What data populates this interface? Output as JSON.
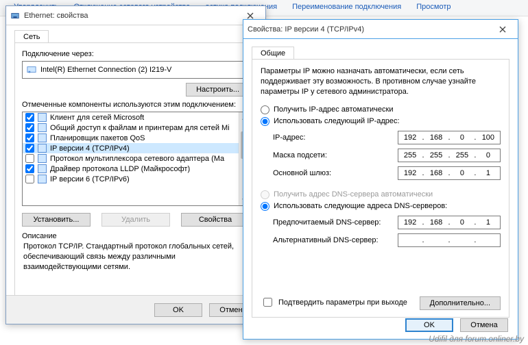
{
  "bgmenu": [
    "Упорядочить",
    "Отключение сетевого устройства",
    "остика подключения",
    "Переименование подключения",
    "Просмотр"
  ],
  "watermark": "Udifil для forum.onliner.by",
  "w1": {
    "title": "Ethernet: свойства",
    "tab": "Сеть",
    "connect_label": "Подключение через:",
    "adapter": "Intel(R) Ethernet Connection (2) I219-V",
    "configure": "Настроить...",
    "components_label": "Отмеченные компоненты используются этим подключением:",
    "items": [
      {
        "chk": true,
        "label": "Клиент для сетей Microsoft"
      },
      {
        "chk": true,
        "label": "Общий доступ к файлам и принтерам для сетей Mi"
      },
      {
        "chk": true,
        "label": "Планировщик пакетов QoS"
      },
      {
        "chk": true,
        "label": "IP версии 4 (TCP/IPv4)",
        "sel": true
      },
      {
        "chk": false,
        "label": "Протокол мультиплексора сетевого адаптера (Ма"
      },
      {
        "chk": true,
        "label": "Драйвер протокола LLDP (Майкрософт)"
      },
      {
        "chk": false,
        "label": "IP версии 6 (TCP/IPv6)"
      }
    ],
    "install": "Установить...",
    "remove": "Удалить",
    "props": "Свойства",
    "desc_label": "Описание",
    "desc_body": "Протокол TCP/IP. Стандартный протокол глобальных сетей, обеспечивающий связь между различными взаимодействующими сетями.",
    "ok": "OK",
    "cancel": "Отмена"
  },
  "w2": {
    "title": "Свойства: IP версии 4 (TCP/IPv4)",
    "tab": "Общие",
    "para": "Параметры IP можно назначать автоматически, если сеть поддерживает эту возможность. В противном случае узнайте параметры IP у сетевого администратора.",
    "r_auto_ip": "Получить IP-адрес автоматически",
    "r_use_ip": "Использовать следующий IP-адрес:",
    "ip_label": "IP-адрес:",
    "ip": [
      "192",
      "168",
      "0",
      "100"
    ],
    "mask_label": "Маска подсети:",
    "mask": [
      "255",
      "255",
      "255",
      "0"
    ],
    "gw_label": "Основной шлюз:",
    "gw": [
      "192",
      "168",
      "0",
      "1"
    ],
    "r_auto_dns": "Получить адрес DNS-сервера автоматически",
    "r_use_dns": "Использовать следующие адреса DNS-серверов:",
    "dns1_label": "Предпочитаемый DNS-сервер:",
    "dns1": [
      "192",
      "168",
      "0",
      "1"
    ],
    "dns2_label": "Альтернативный DNS-сервер:",
    "dns2": [
      "",
      "",
      "",
      ""
    ],
    "validate": "Подтвердить параметры при выходе",
    "advanced": "Дополнительно...",
    "ok": "OK",
    "cancel": "Отмена"
  }
}
